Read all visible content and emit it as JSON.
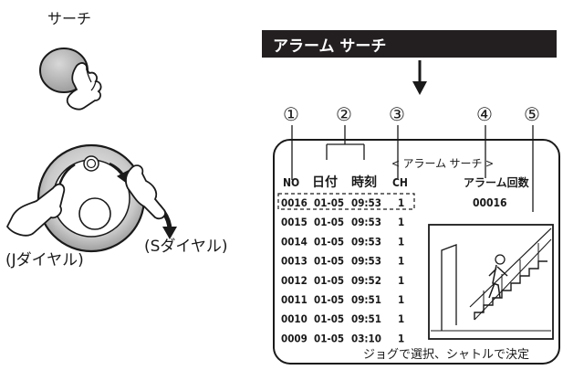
{
  "search_button": {
    "label": "サーチ"
  },
  "jog_shuttle": {
    "jog_label": "(Jダイヤル)",
    "shuttle_label": "(Sダイヤル)"
  },
  "banner": {
    "title": "アラーム サーチ"
  },
  "callouts": [
    "①",
    "②",
    "③",
    "④",
    "⑤"
  ],
  "screen": {
    "heading": "< アラーム サーチ >",
    "columns": {
      "no": "NO",
      "date": "日付",
      "time": "時刻",
      "ch": "CH",
      "alarm_count": "アラーム回数"
    },
    "alarm_count_value": "00016",
    "rows": [
      {
        "no": "0016",
        "date": "01-05",
        "time": "09:53",
        "ch": "1"
      },
      {
        "no": "0015",
        "date": "01-05",
        "time": "09:53",
        "ch": "1"
      },
      {
        "no": "0014",
        "date": "01-05",
        "time": "09:53",
        "ch": "1"
      },
      {
        "no": "0013",
        "date": "01-05",
        "time": "09:53",
        "ch": "1"
      },
      {
        "no": "0012",
        "date": "01-05",
        "time": "09:52",
        "ch": "1"
      },
      {
        "no": "0011",
        "date": "01-05",
        "time": "09:51",
        "ch": "1"
      },
      {
        "no": "0010",
        "date": "01-05",
        "time": "09:51",
        "ch": "1"
      },
      {
        "no": "0009",
        "date": "01-05",
        "time": "03:10",
        "ch": "1"
      }
    ],
    "footer": "ジョグで選択、シャトルで決定"
  }
}
